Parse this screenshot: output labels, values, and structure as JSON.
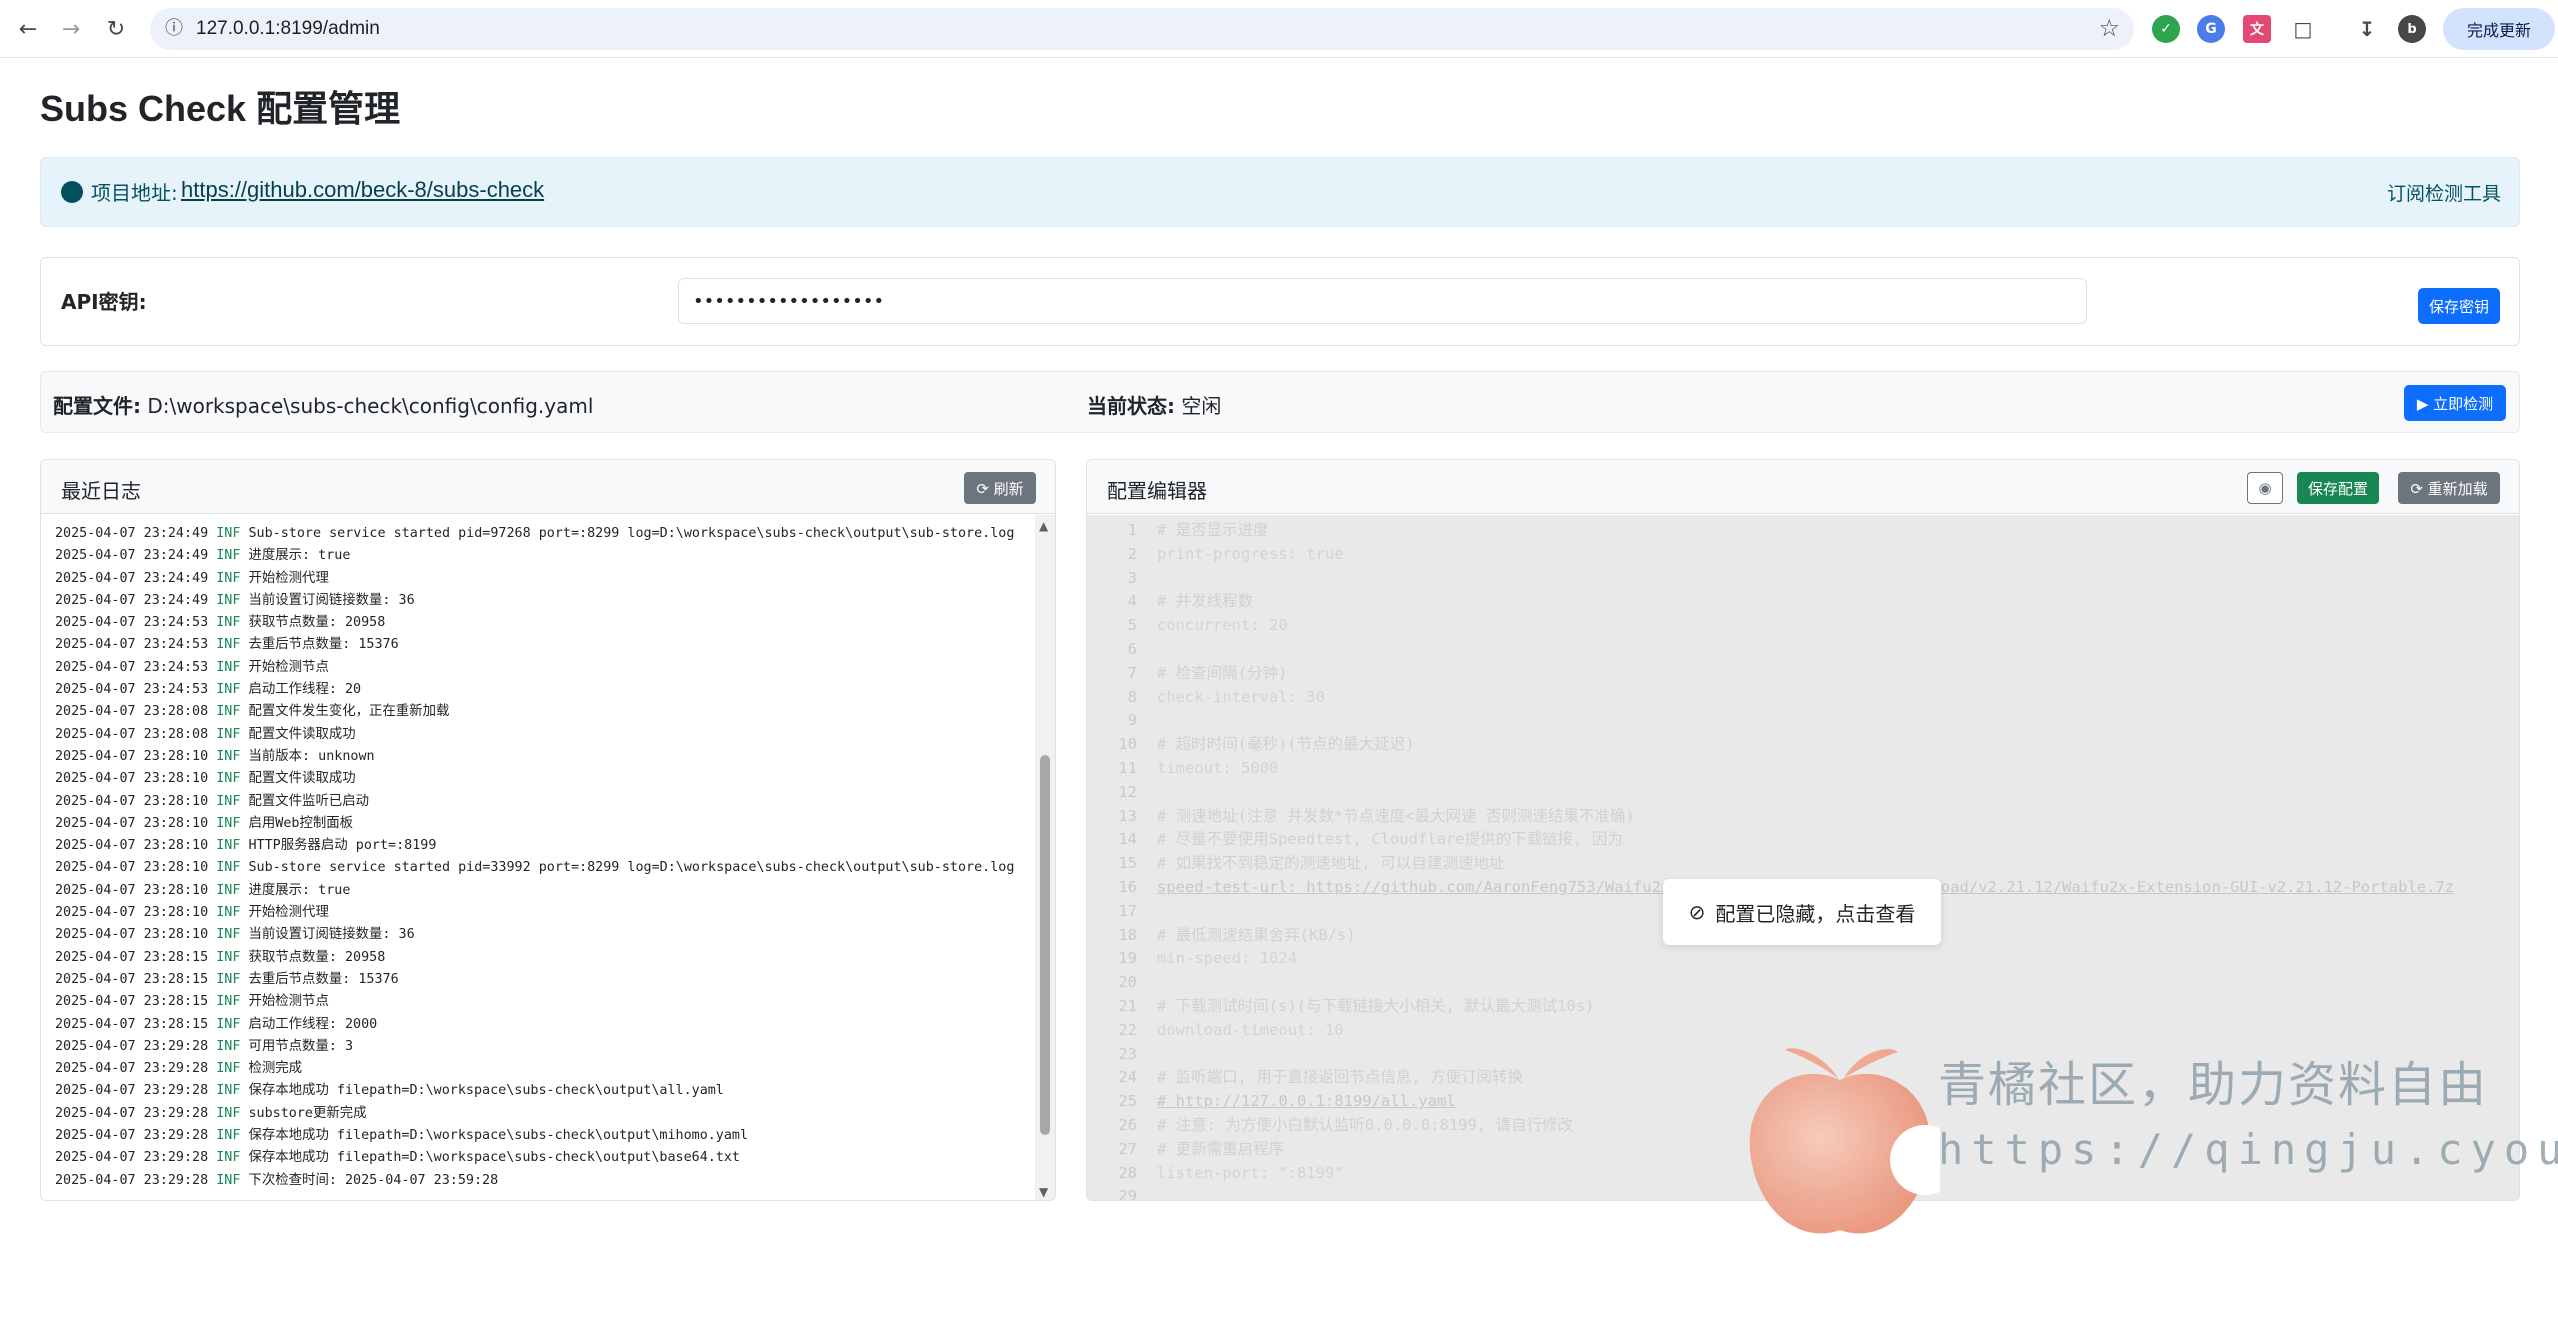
{
  "browser": {
    "url": "127.0.0.1:8199/admin",
    "update_label": "完成更新",
    "profile_initial": "b"
  },
  "page": {
    "title": "Subs Check 配置管理"
  },
  "info": {
    "label": "项目地址:",
    "link": "https://github.com/beck-8/subs-check",
    "right_text": "订阅检测工具"
  },
  "api": {
    "label": "API密钥:",
    "value": "••••••••••••••••••",
    "save_label": "保存密钥"
  },
  "status": {
    "config_label": "配置文件:",
    "config_path": "D:\\workspace\\subs-check\\config\\config.yaml",
    "state_label": "当前状态:",
    "state_value": "空闲",
    "run_label": "▶ 立即检测"
  },
  "log_panel": {
    "title": "最近日志",
    "refresh_label": "⟳ 刷新",
    "lines": [
      {
        "t": "2025-04-07 23:24:49",
        "lv": "INF",
        "msg": "Sub-store service started pid=97268 port=:8299 log=D:\\workspace\\subs-check\\output\\sub-store.log"
      },
      {
        "t": "2025-04-07 23:24:49",
        "lv": "INF",
        "msg": "进度展示: true"
      },
      {
        "t": "2025-04-07 23:24:49",
        "lv": "INF",
        "msg": "开始检测代理"
      },
      {
        "t": "2025-04-07 23:24:49",
        "lv": "INF",
        "msg": "当前设置订阅链接数量: 36"
      },
      {
        "t": "2025-04-07 23:24:53",
        "lv": "INF",
        "msg": "获取节点数量: 20958"
      },
      {
        "t": "2025-04-07 23:24:53",
        "lv": "INF",
        "msg": "去重后节点数量: 15376"
      },
      {
        "t": "2025-04-07 23:24:53",
        "lv": "INF",
        "msg": "开始检测节点"
      },
      {
        "t": "2025-04-07 23:24:53",
        "lv": "INF",
        "msg": "启动工作线程: 20"
      },
      {
        "t": "2025-04-07 23:28:08",
        "lv": "INF",
        "msg": "配置文件发生变化，正在重新加载"
      },
      {
        "t": "2025-04-07 23:28:08",
        "lv": "INF",
        "msg": "配置文件读取成功"
      },
      {
        "t": "2025-04-07 23:28:10",
        "lv": "INF",
        "msg": "当前版本: unknown"
      },
      {
        "t": "2025-04-07 23:28:10",
        "lv": "INF",
        "msg": "配置文件读取成功"
      },
      {
        "t": "2025-04-07 23:28:10",
        "lv": "INF",
        "msg": "配置文件监听已启动"
      },
      {
        "t": "2025-04-07 23:28:10",
        "lv": "INF",
        "msg": "启用Web控制面板"
      },
      {
        "t": "2025-04-07 23:28:10",
        "lv": "INF",
        "msg": "HTTP服务器启动 port=:8199"
      },
      {
        "t": "2025-04-07 23:28:10",
        "lv": "INF",
        "msg": "Sub-store service started pid=33992 port=:8299 log=D:\\workspace\\subs-check\\output\\sub-store.log"
      },
      {
        "t": "2025-04-07 23:28:10",
        "lv": "INF",
        "msg": "进度展示: true"
      },
      {
        "t": "2025-04-07 23:28:10",
        "lv": "INF",
        "msg": "开始检测代理"
      },
      {
        "t": "2025-04-07 23:28:10",
        "lv": "INF",
        "msg": "当前设置订阅链接数量: 36"
      },
      {
        "t": "2025-04-07 23:28:15",
        "lv": "INF",
        "msg": "获取节点数量: 20958"
      },
      {
        "t": "2025-04-07 23:28:15",
        "lv": "INF",
        "msg": "去重后节点数量: 15376"
      },
      {
        "t": "2025-04-07 23:28:15",
        "lv": "INF",
        "msg": "开始检测节点"
      },
      {
        "t": "2025-04-07 23:28:15",
        "lv": "INF",
        "msg": "启动工作线程: 2000"
      },
      {
        "t": "2025-04-07 23:29:28",
        "lv": "INF",
        "msg": "可用节点数量: 3"
      },
      {
        "t": "2025-04-07 23:29:28",
        "lv": "INF",
        "msg": "检测完成"
      },
      {
        "t": "2025-04-07 23:29:28",
        "lv": "INF",
        "msg": "保存本地成功 filepath=D:\\workspace\\subs-check\\output\\all.yaml"
      },
      {
        "t": "2025-04-07 23:29:28",
        "lv": "INF",
        "msg": "substore更新完成"
      },
      {
        "t": "2025-04-07 23:29:28",
        "lv": "INF",
        "msg": "保存本地成功 filepath=D:\\workspace\\subs-check\\output\\mihomo.yaml"
      },
      {
        "t": "2025-04-07 23:29:28",
        "lv": "INF",
        "msg": "保存本地成功 filepath=D:\\workspace\\subs-check\\output\\base64.txt"
      },
      {
        "t": "2025-04-07 23:29:28",
        "lv": "INF",
        "msg": "下次检查时间: 2025-04-07 23:59:28"
      }
    ]
  },
  "config_panel": {
    "title": "配置编辑器",
    "save_label": "保存配置",
    "reload_label": "⟳ 重新加载",
    "hidden_notice": "配置已隐藏，点击查看",
    "lines": [
      {
        "n": "1",
        "kind": "cm",
        "text": "# 是否显示进度"
      },
      {
        "n": "2",
        "kind": "k",
        "text": "print-progress: true"
      },
      {
        "n": "3",
        "kind": "",
        "text": ""
      },
      {
        "n": "4",
        "kind": "cm",
        "text": "# 并发线程数"
      },
      {
        "n": "5",
        "kind": "k",
        "text": "concurrent: 20"
      },
      {
        "n": "6",
        "kind": "",
        "text": ""
      },
      {
        "n": "7",
        "kind": "cm",
        "text": "# 检查间隔(分钟)"
      },
      {
        "n": "8",
        "kind": "k",
        "text": "check-interval: 30"
      },
      {
        "n": "9",
        "kind": "",
        "text": ""
      },
      {
        "n": "10",
        "kind": "cm",
        "text": "# 超时时间(毫秒)(节点的最大延迟)"
      },
      {
        "n": "11",
        "kind": "k",
        "text": "timeout: 5000"
      },
      {
        "n": "12",
        "kind": "",
        "text": ""
      },
      {
        "n": "13",
        "kind": "cm",
        "text": "# 测速地址(注意 并发数*节点速度<最大网速 否则测速结果不准确)"
      },
      {
        "n": "14",
        "kind": "cm",
        "text": "# 尽量不要使用Speedtest, Cloudflare提供的下载链接, 因为"
      },
      {
        "n": "15",
        "kind": "cm",
        "text": "# 如果找不到稳定的测速地址, 可以自建测速地址"
      },
      {
        "n": "16",
        "kind": "u",
        "text": "speed-test-url: https://github.com/AaronFeng753/Waifu2x-Extension-GUI/releases/download/v2.21.12/Waifu2x-Extension-GUI-v2.21.12-Portable.7z"
      },
      {
        "n": "17",
        "kind": "",
        "text": ""
      },
      {
        "n": "18",
        "kind": "cm",
        "text": "# 最低测速结果舍弃(KB/s)"
      },
      {
        "n": "19",
        "kind": "k",
        "text": "min-speed: 1024"
      },
      {
        "n": "20",
        "kind": "",
        "text": ""
      },
      {
        "n": "21",
        "kind": "cm",
        "text": "# 下载测试时间(s)(与下载链接大小相关, 默认最大测试10s)"
      },
      {
        "n": "22",
        "kind": "k",
        "text": "download-timeout: 10"
      },
      {
        "n": "23",
        "kind": "",
        "text": ""
      },
      {
        "n": "24",
        "kind": "cm",
        "text": "# 监听端口, 用于直接返回节点信息, 方便订阅转换"
      },
      {
        "n": "25",
        "kind": "u",
        "text": "# http://127.0.0.1:8199/all.yaml"
      },
      {
        "n": "26",
        "kind": "cm",
        "text": "# 注意: 为方便小白默认监听0.0.0.0:8199, 请自行修改"
      },
      {
        "n": "27",
        "kind": "cm",
        "text": "# 更新需重启程序"
      },
      {
        "n": "28",
        "kind": "k",
        "text": "listen-port: \":8199\""
      },
      {
        "n": "29",
        "kind": "",
        "text": ""
      }
    ]
  },
  "watermark": {
    "line1": "青橘社区，助力资料自由",
    "line2": "https://qingju.cyou"
  },
  "colors": {
    "primary": "#0d6efd",
    "success": "#198754",
    "secondary": "#6c757d",
    "info_bg": "#e7f3fb"
  }
}
